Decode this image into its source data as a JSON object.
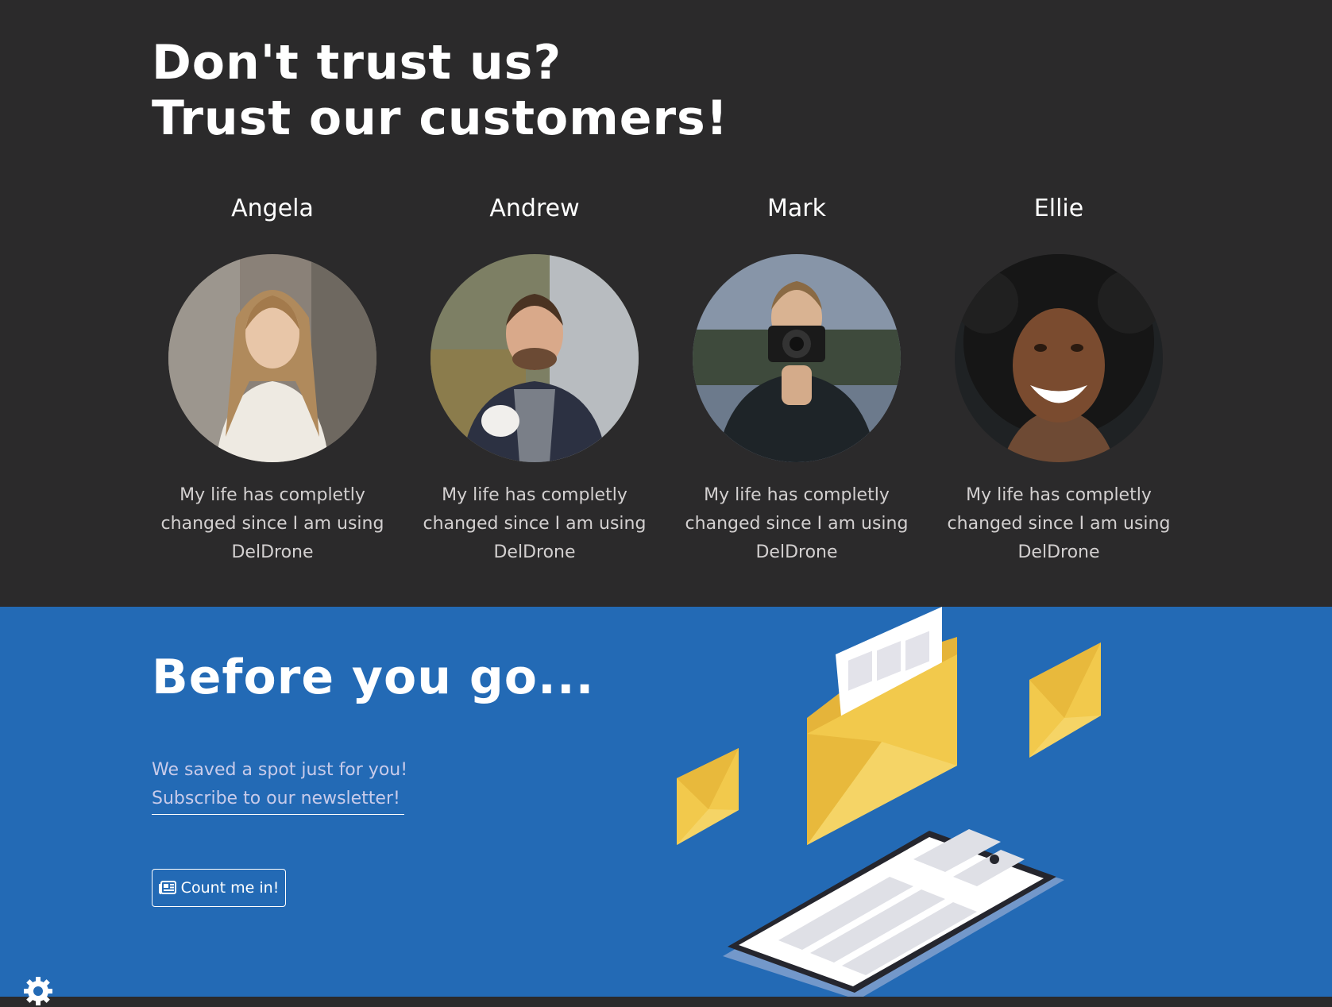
{
  "testimonials": {
    "title_line1": "Don't trust us?",
    "title_line2": "Trust our customers!",
    "customers": [
      {
        "name": "Angela",
        "quote": "My life has completly changed since I am using DelDrone"
      },
      {
        "name": "Andrew",
        "quote": "My life has completly changed since I am using DelDrone"
      },
      {
        "name": "Mark",
        "quote": "My life has completly changed since I am using DelDrone"
      },
      {
        "name": "Ellie",
        "quote": "My life has completly changed since I am using DelDrone"
      }
    ]
  },
  "newsletter": {
    "title": "Before you go...",
    "line1": "We saved a spot just for you!",
    "line2": "Subscribe to our newsletter!",
    "email_placeholder": "",
    "button_label": "Count me in!",
    "button_icon": "newspaper-icon"
  },
  "settings": {
    "icon": "gear-icon"
  },
  "colors": {
    "dark_bg": "#2b2a2b",
    "newsletter_bg": "#236ab5",
    "envelope_yellow": "#f2c94c",
    "quote_text": "#d3d0d0"
  }
}
